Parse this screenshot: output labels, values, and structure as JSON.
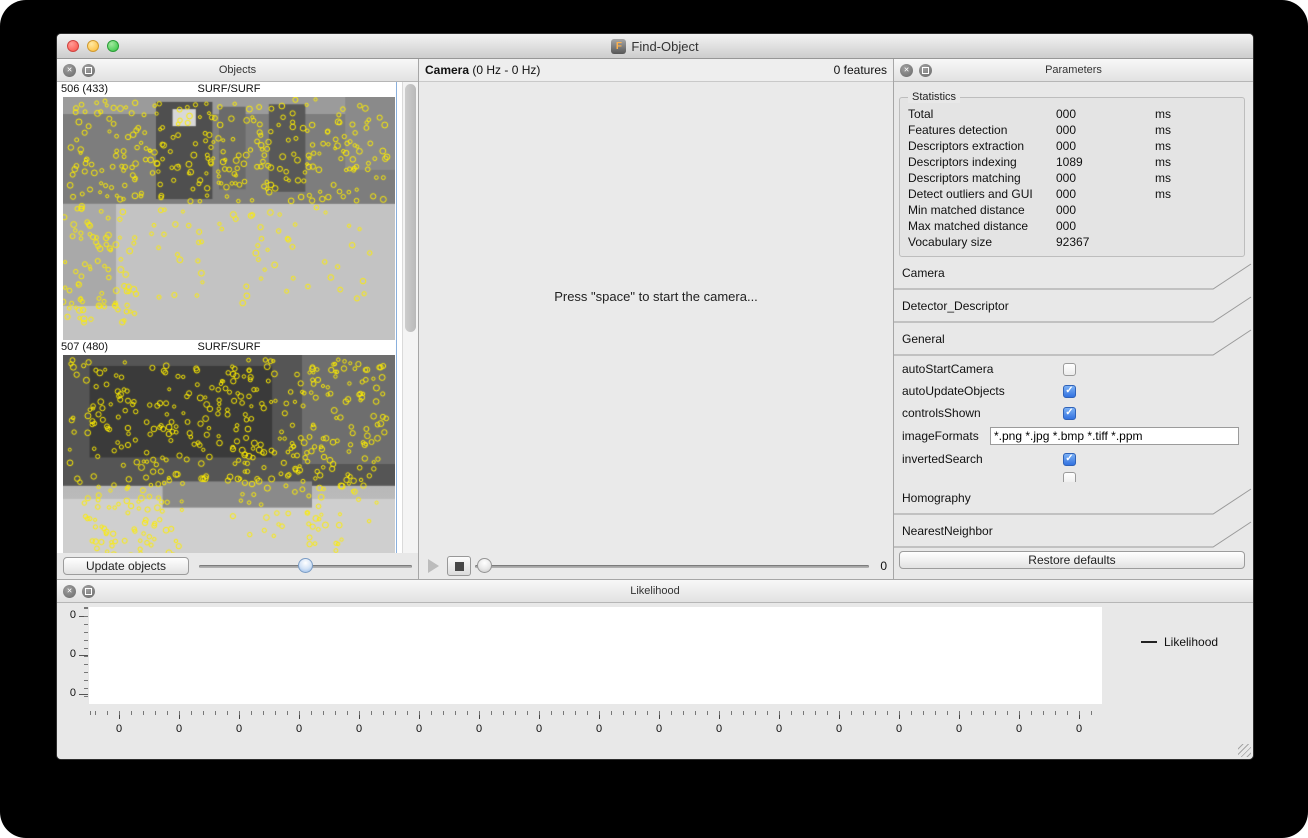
{
  "window": {
    "title": "Find-Object"
  },
  "objects_panel": {
    "title": "Objects",
    "items": [
      {
        "id": "506 (433)",
        "detector": "SURF/SURF",
        "feature_count": 433
      },
      {
        "id": "507 (480)",
        "detector": "SURF/SURF",
        "feature_count": 480
      }
    ],
    "update_button": "Update objects",
    "feature_color": "#ffee00"
  },
  "camera_panel": {
    "title": "Camera",
    "rate": "(0 Hz - 0 Hz)",
    "features_label": "0 features",
    "message": "Press \"space\" to start the camera...",
    "frame_counter": "0"
  },
  "parameters_panel": {
    "title": "Parameters",
    "statistics": {
      "title": "Statistics",
      "rows": [
        {
          "label": "Total",
          "value": "000",
          "unit": "ms"
        },
        {
          "label": "Features detection",
          "value": "000",
          "unit": "ms"
        },
        {
          "label": "Descriptors extraction",
          "value": "000",
          "unit": "ms"
        },
        {
          "label": "Descriptors indexing",
          "value": "1089",
          "unit": "ms"
        },
        {
          "label": "Descriptors matching",
          "value": "000",
          "unit": "ms"
        },
        {
          "label": "Detect outliers and GUI",
          "value": "000",
          "unit": "ms"
        },
        {
          "label": "Min matched distance",
          "value": "000",
          "unit": ""
        },
        {
          "label": "Max matched distance",
          "value": "000",
          "unit": ""
        },
        {
          "label": "Vocabulary size",
          "value": "92367",
          "unit": ""
        }
      ]
    },
    "sections_before": [
      "Camera",
      "Detector_Descriptor",
      "General"
    ],
    "general": {
      "items": [
        {
          "label": "autoStartCamera",
          "type": "checkbox",
          "checked": false
        },
        {
          "label": "autoUpdateObjects",
          "type": "checkbox",
          "checked": true
        },
        {
          "label": "controlsShown",
          "type": "checkbox",
          "checked": true
        },
        {
          "label": "imageFormats",
          "type": "text",
          "value": "*.png *.jpg *.bmp *.tiff *.ppm"
        },
        {
          "label": "invertedSearch",
          "type": "checkbox",
          "checked": true
        },
        {
          "label": "",
          "type": "checkbox",
          "checked": false,
          "clipped": true
        }
      ]
    },
    "sections_after": [
      "Homography",
      "NearestNeighbor"
    ],
    "restore_button": "Restore defaults",
    "checked_color": "#3272e0"
  },
  "likelihood_panel": {
    "title": "Likelihood",
    "legend": "Likelihood",
    "y_ticks": [
      "0",
      "0",
      "0"
    ],
    "x_ticks": [
      "0",
      "0",
      "0",
      "0",
      "0",
      "0",
      "0",
      "0",
      "0",
      "0",
      "0",
      "0",
      "0",
      "0",
      "0",
      "0",
      "0"
    ]
  }
}
